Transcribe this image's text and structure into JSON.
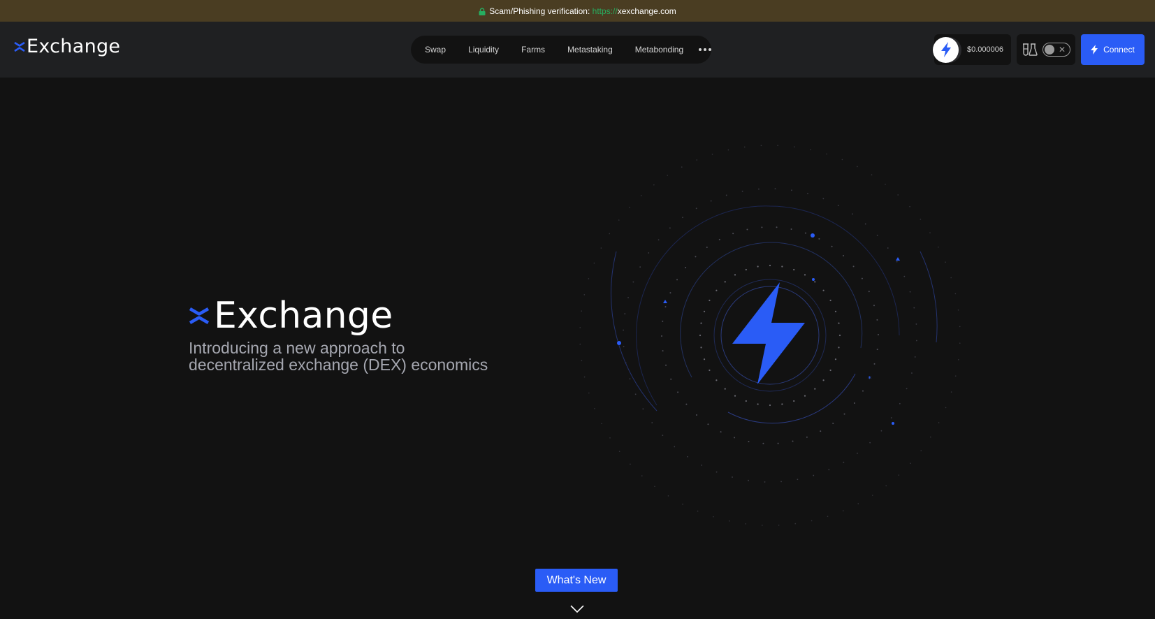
{
  "banner": {
    "label": "Scam/Phishing verification:",
    "url_protocol": "https://",
    "url_domain": "xexchange.com",
    "icon": "lock-icon",
    "protocol_color": "#27ae60"
  },
  "header": {
    "logo_text": "Exchange",
    "nav": [
      {
        "label": "Swap"
      },
      {
        "label": "Liquidity"
      },
      {
        "label": "Farms"
      },
      {
        "label": "Metastaking"
      },
      {
        "label": "Metabonding"
      }
    ],
    "more_icon": "more-dots-icon",
    "price": "$0.000006",
    "connect_label": "Connect"
  },
  "hero": {
    "logo_text": "Exchange",
    "tagline_line1": "Introducing a new approach to",
    "tagline_line2": "decentralized exchange (DEX) economics",
    "whats_new_label": "What's New"
  },
  "colors": {
    "accent": "#2a5cf6",
    "background": "#121212",
    "header": "#1f2022",
    "banner": "#4a3d22"
  }
}
